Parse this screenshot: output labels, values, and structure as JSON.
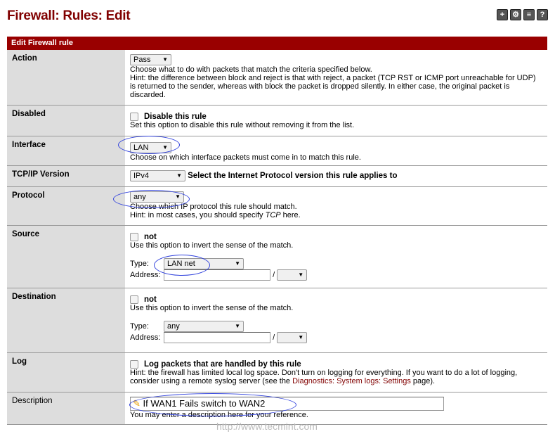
{
  "title": "Firewall: Rules: Edit",
  "header_icons": [
    "add-icon",
    "gear-icon",
    "list-icon",
    "help-icon"
  ],
  "section": "Edit Firewall rule",
  "action": {
    "label": "Action",
    "value": "Pass",
    "hint1": "Choose what to do with packets that match the criteria specified below.",
    "hint2": "Hint: the difference between block and reject is that with reject, a packet (TCP RST or ICMP port unreachable for UDP) is returned to the sender, whereas with block the packet is dropped silently. In either case, the original packet is discarded."
  },
  "disabled": {
    "label": "Disabled",
    "check": "Disable this rule",
    "hint": "Set this option to disable this rule without removing it from the list."
  },
  "interface": {
    "label": "Interface",
    "value": "LAN",
    "hint": "Choose on which interface packets must come in to match this rule."
  },
  "ipver": {
    "label": "TCP/IP Version",
    "value": "IPv4",
    "hint": "Select the Internet Protocol version this rule applies to"
  },
  "protocol": {
    "label": "Protocol",
    "value": "any",
    "hint1": "Choose which IP protocol this rule should match.",
    "hint2a": "Hint: in most cases, you should specify ",
    "hint2b": "TCP",
    "hint2c": "  here."
  },
  "source": {
    "label": "Source",
    "check": "not",
    "hint": "Use this option to invert the sense of the match.",
    "type_label": "Type:",
    "type": "LAN net",
    "addr_label": "Address:",
    "slash": "/"
  },
  "destination": {
    "label": "Destination",
    "check": "not",
    "hint": "Use this option to invert the sense of the match.",
    "type_label": "Type:",
    "type": "any",
    "addr_label": "Address:",
    "slash": "/"
  },
  "log": {
    "label": "Log",
    "check": "Log packets that are handled by this rule",
    "hint1": "Hint: the firewall has limited local log space. Don't turn on logging for everything. If you want to do a lot of logging, consider using a remote syslog server (see the ",
    "link": "Diagnostics: System logs: Settings",
    "hint2": " page)."
  },
  "description": {
    "label": "Description",
    "value": "If WAN1 Fails switch to WAN2",
    "hint": "You may enter a description here for your reference."
  },
  "watermark": "http://www.tecmint.com"
}
